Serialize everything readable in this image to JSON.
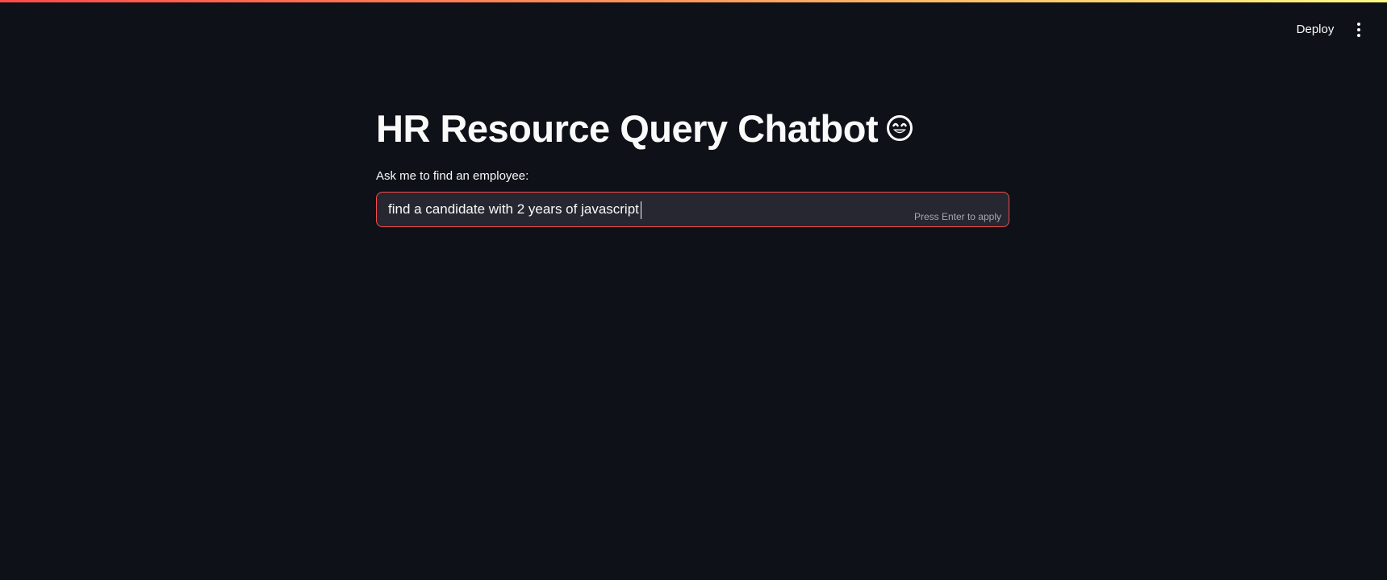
{
  "header": {
    "deploy_label": "Deploy",
    "menu_icon": "vertical-ellipsis-icon"
  },
  "main": {
    "title": "HR Resource Query Chatbot",
    "title_icon": "smiling-face-emoji-icon",
    "input": {
      "label": "Ask me to find an employee:",
      "value": "find a candidate with 2 years of javascript",
      "hint": "Press Enter to apply"
    }
  },
  "colors": {
    "background": "#0e1117",
    "input_background": "#262730",
    "focus_border": "#ff4b4b",
    "text": "#fafafa",
    "hint_text": "#a3a8b8"
  }
}
